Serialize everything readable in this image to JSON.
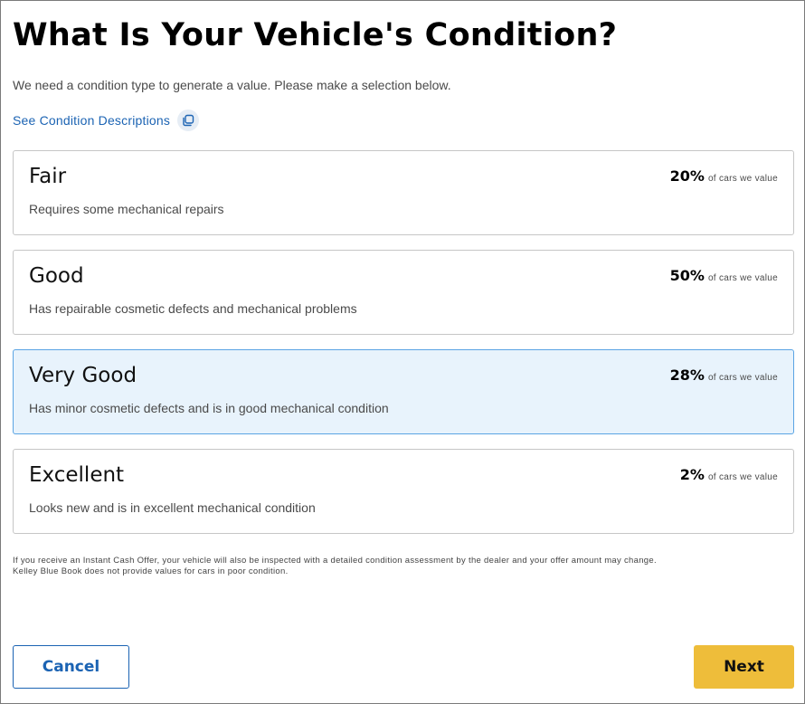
{
  "header": {
    "title": "What Is Your Vehicle's Condition?",
    "subtitle": "We need a condition type to generate a value. Please make a selection below."
  },
  "descriptions_link": {
    "label": "See Condition Descriptions",
    "icon": "copy-icon"
  },
  "conditions": [
    {
      "title": "Fair",
      "description": "Requires some mechanical repairs",
      "percent": "20%",
      "suffix": "of cars we value",
      "selected": false
    },
    {
      "title": "Good",
      "description": "Has repairable cosmetic defects and mechanical problems",
      "percent": "50%",
      "suffix": "of cars we value",
      "selected": false
    },
    {
      "title": "Very Good",
      "description": "Has minor cosmetic defects and is in good mechanical condition",
      "percent": "28%",
      "suffix": "of cars we value",
      "selected": true
    },
    {
      "title": "Excellent",
      "description": "Looks new and is in excellent mechanical condition",
      "percent": "2%",
      "suffix": "of cars we value",
      "selected": false
    }
  ],
  "disclaimer": {
    "line1": "If you receive an Instant Cash Offer, your vehicle will also be inspected with a detailed condition assessment by the dealer and your offer amount may change.",
    "line2": "Kelley Blue Book does not provide values for cars in poor condition."
  },
  "buttons": {
    "cancel": "Cancel",
    "next": "Next"
  },
  "colors": {
    "link": "#1b63b3",
    "selected_bg": "#e8f3fc",
    "selected_border": "#5aa4e4",
    "next_bg": "#eebd3a"
  }
}
